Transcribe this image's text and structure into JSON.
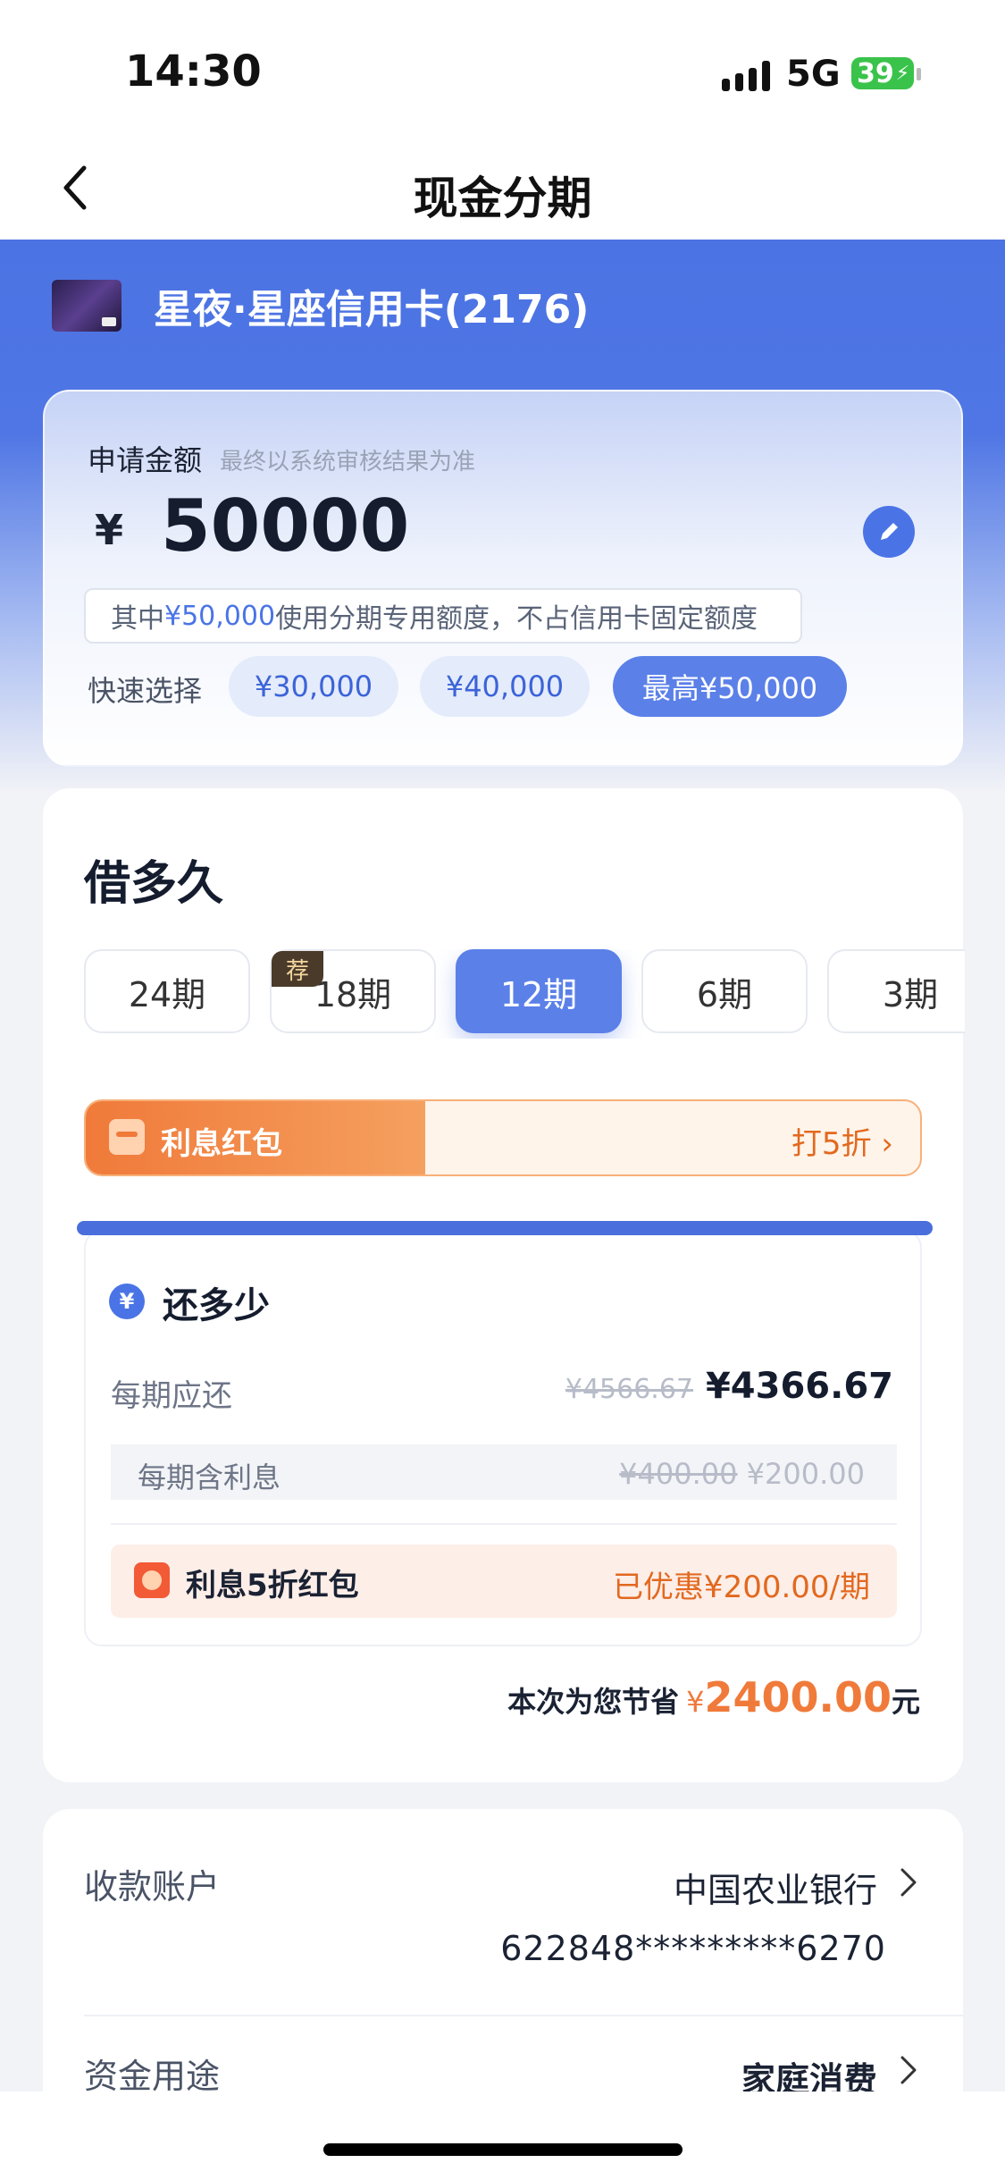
{
  "status_bar": {
    "time": "14:30",
    "network": "5G",
    "battery": "39"
  },
  "nav": {
    "title": "现金分期"
  },
  "card": {
    "name": "星夜·星座信用卡(2176)"
  },
  "amount": {
    "label": "申请金额",
    "hint": "最终以系统审核结果为准",
    "currency": "¥",
    "value": "50000",
    "note_prefix": "其中",
    "note_amount": "¥50,000",
    "note_suffix": "使用分期专用额度，不占信用卡固定额度",
    "quick_label": "快速选择",
    "quick_options": [
      "¥30,000",
      "¥40,000",
      "最高¥50,000"
    ],
    "quick_selected": "最高¥50,000"
  },
  "term": {
    "title": "借多久",
    "options": [
      "24期",
      "18期",
      "12期",
      "6期",
      "3期"
    ],
    "selected": "12期",
    "recommend_tag": "荐"
  },
  "coupon": {
    "label": "利息红包",
    "action": "打5折"
  },
  "repay": {
    "title": "还多少",
    "icon_text": "¥",
    "per_period_label": "每期应还",
    "per_period_original": "¥4566.67",
    "per_period_value": "¥4366.67",
    "interest_label": "每期含利息",
    "interest_original": "¥400.00",
    "interest_value": "¥200.00",
    "discount_label": "利息5折红包",
    "discount_value": "已优惠¥200.00/期"
  },
  "savings": {
    "label": "本次为您节省",
    "currency": "¥",
    "amount": "2400.00",
    "unit": "元"
  },
  "account": {
    "label": "收款账户",
    "bank": "中国农业银行",
    "number": "622848*********6270",
    "purpose_label": "资金用途",
    "purpose_value": "家庭消费"
  },
  "colors": {
    "brand_blue": "#4c73e3",
    "accent_orange": "#f07a3a"
  }
}
